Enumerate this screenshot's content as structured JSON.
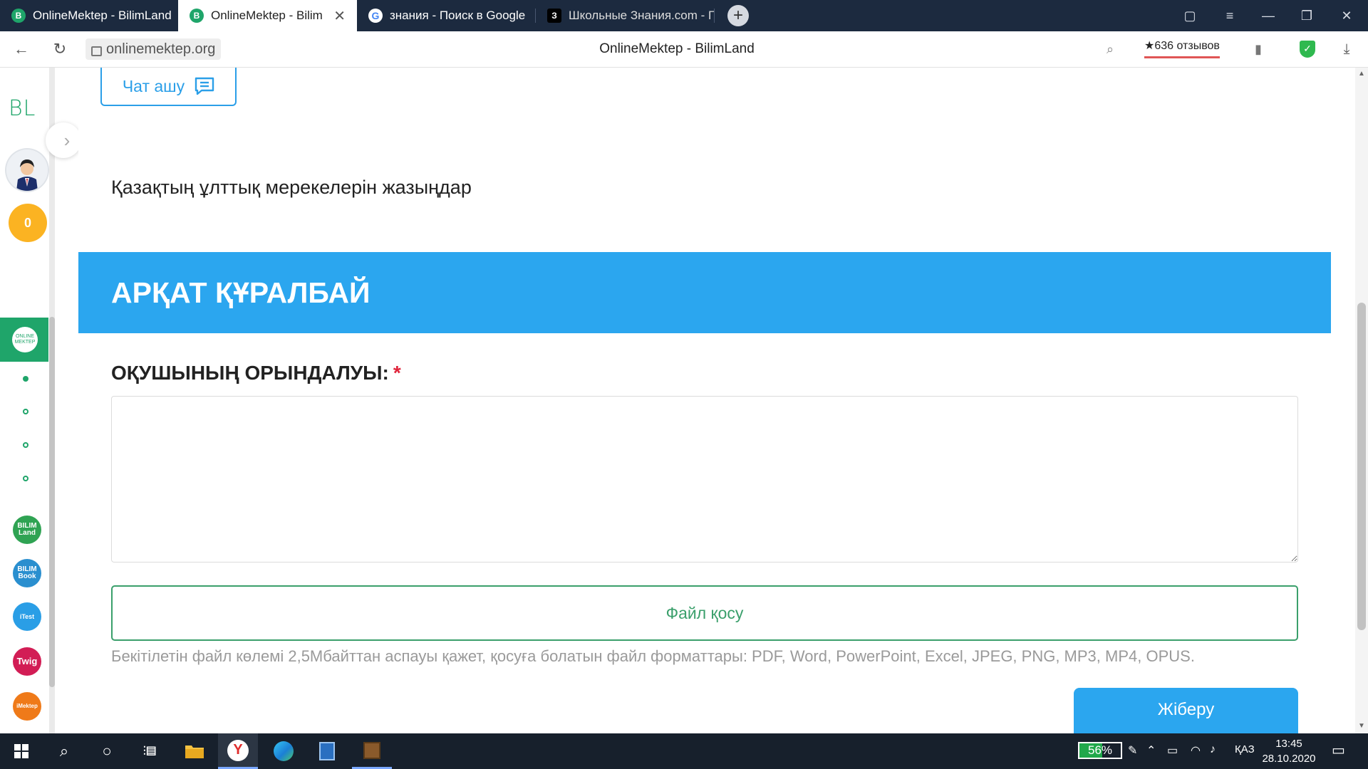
{
  "browser": {
    "tabs": [
      {
        "label": "OnlineMektep - BilimLand",
        "favicon": "bilimland-icon",
        "active": false
      },
      {
        "label": "OnlineMektep - BilimLand",
        "favicon": "bilimland-icon",
        "active": true
      },
      {
        "label": "знания - Поиск в Google",
        "favicon": "google-icon",
        "active": false
      },
      {
        "label": "Школьные Знания.com - Г",
        "favicon": "znania-icon",
        "active": false
      }
    ],
    "url": "onlinemektep.org",
    "page_title": "OnlineMektep - BilimLand",
    "reviews_label": "★636 отзывов"
  },
  "sidebar": {
    "logo": "BL",
    "coins": "0",
    "active_app": "ONLINE MEKTEP",
    "apps": [
      {
        "label": "BILIM Land",
        "color": "#2fa353"
      },
      {
        "label": "BILIM Book",
        "color": "#2a8fcf"
      },
      {
        "label": "iTest",
        "color": "#2a9ee6"
      },
      {
        "label": "Twig",
        "color": "#d21d55"
      },
      {
        "label": "iMektep",
        "color": "#ef7a19"
      }
    ]
  },
  "page": {
    "chat_button": "Чат ашу",
    "task_text": "Қазақтың ұлттық мерекелерін жазыңдар",
    "student_name": "АРҚАТ ҚҰРАЛБАЙ",
    "answer_label": "ОҚУШЫНЫҢ ОРЫНДАЛУЫ:",
    "required_mark": "*",
    "answer_value": "",
    "attach_button": "Файл қосу",
    "file_hint": "Бекітілетін файл көлемі 2,5Мбайттан аспауы қажет, қосуға болатын файл форматтары: PDF, Word, PowerPoint, Excel, JPEG, PNG, MP3, MP4, OPUS.",
    "send_button": "Жіберу"
  },
  "taskbar": {
    "battery": "56%",
    "battery_level": 0.56,
    "language": "ҚАЗ",
    "time": "13:45",
    "date": "28.10.2020"
  },
  "colors": {
    "accent_blue": "#2ba6ef",
    "brand_green": "#1fa56a",
    "tab_strip": "#1c2a3f"
  }
}
